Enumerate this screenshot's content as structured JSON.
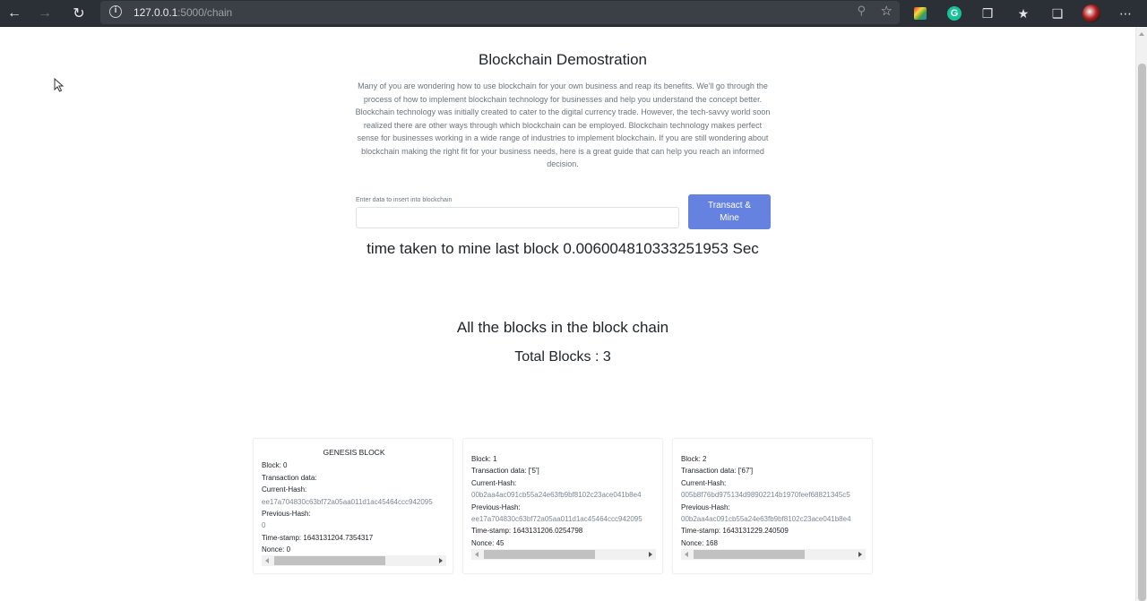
{
  "browser": {
    "url_host": "127.0.0.1",
    "url_rest": ":5000/chain"
  },
  "page": {
    "title": "Blockchain Demostration",
    "description": "Many of you are wondering how to use blockchain for your own business and reap its benefits. We'll go through the process of how to implement blockchain technology for businesses and help you understand the concept better. Blockchain technology was initially created to cater to the digital currency trade. However, the tech-savvy world soon realized there are other ways through which blockchain can be employed. Blockchain technology makes perfect sense for businesses working in a wide range of industries to implement blockchain. If you are still wondering about blockchain making the right fit for your business needs, here is a great guide that can help you reach an informed decision.",
    "input_label": "Enter data to insert into blockchain",
    "input_value": "",
    "mine_button": "Transact & Mine",
    "time_taken": "time taken to mine last block 0.006004810333251953 Sec",
    "all_blocks_heading": "All the blocks in the block chain",
    "total_blocks": "Total Blocks : 3"
  },
  "blocks": [
    {
      "header": "GENESIS BLOCK",
      "block": "Block: 0",
      "transaction": "Transaction data:",
      "current_hash_label": "Current-Hash:",
      "current_hash": "ee17a704830c63bf72a05aa011d1ac45464ccc942095",
      "previous_hash_label": "Previous-Hash:",
      "previous_hash": "0",
      "timestamp": "Time-stamp: 1643131204.7354317",
      "nonce": "Nonce: 0"
    },
    {
      "header": "",
      "block": "Block: 1",
      "transaction": "Transaction data: ['5']",
      "current_hash_label": "Current-Hash:",
      "current_hash": "00b2aa4ac091cb55a24e63fb9bf8102c23ace041b8e4",
      "previous_hash_label": "Previous-Hash:",
      "previous_hash": "ee17a704830c63bf72a05aa011d1ac45464ccc942095",
      "timestamp": "Time-stamp: 1643131206.0254798",
      "nonce": "Nonce: 45"
    },
    {
      "header": "",
      "block": "Block: 2",
      "transaction": "Transaction data: ['67']",
      "current_hash_label": "Current-Hash:",
      "current_hash": "005b8f76bd975134d98902214b1970feef68821345c5",
      "previous_hash_label": "Previous-Hash:",
      "previous_hash": "00b2aa4ac091cb55a24e63fb9bf8102c23ace041b8e4",
      "timestamp": "Time-stamp: 1643131229.240509",
      "nonce": "Nonce: 168"
    }
  ]
}
